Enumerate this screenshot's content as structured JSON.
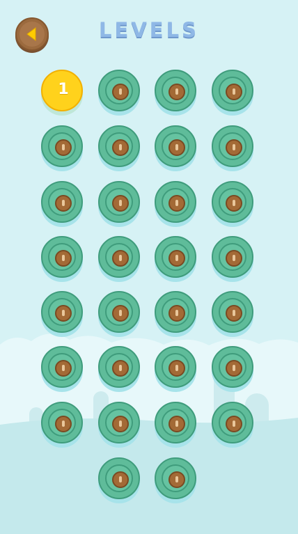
{
  "header": {
    "title": "LEVELS",
    "back_icon": "back-arrow-icon"
  },
  "levels": [
    {
      "label": "1",
      "state": "unlocked"
    },
    {
      "label": "",
      "state": "locked"
    },
    {
      "label": "",
      "state": "locked"
    },
    {
      "label": "",
      "state": "locked"
    },
    {
      "label": "",
      "state": "locked"
    },
    {
      "label": "",
      "state": "locked"
    },
    {
      "label": "",
      "state": "locked"
    },
    {
      "label": "",
      "state": "locked"
    },
    {
      "label": "",
      "state": "locked"
    },
    {
      "label": "",
      "state": "locked"
    },
    {
      "label": "",
      "state": "locked"
    },
    {
      "label": "",
      "state": "locked"
    },
    {
      "label": "",
      "state": "locked"
    },
    {
      "label": "",
      "state": "locked"
    },
    {
      "label": "",
      "state": "locked"
    },
    {
      "label": "",
      "state": "locked"
    },
    {
      "label": "",
      "state": "locked"
    },
    {
      "label": "",
      "state": "locked"
    },
    {
      "label": "",
      "state": "locked"
    },
    {
      "label": "",
      "state": "locked"
    },
    {
      "label": "",
      "state": "locked"
    },
    {
      "label": "",
      "state": "locked"
    },
    {
      "label": "",
      "state": "locked"
    },
    {
      "label": "",
      "state": "locked"
    },
    {
      "label": "",
      "state": "locked"
    },
    {
      "label": "",
      "state": "locked"
    },
    {
      "label": "",
      "state": "locked"
    },
    {
      "label": "",
      "state": "locked"
    },
    {
      "label": "",
      "state": "locked"
    },
    {
      "label": "",
      "state": "locked"
    }
  ],
  "colors": {
    "background": "#d6f2f5",
    "level_locked": "#5fbc9a",
    "level_unlocked": "#ffd21c",
    "title": "#8fb8e6"
  }
}
